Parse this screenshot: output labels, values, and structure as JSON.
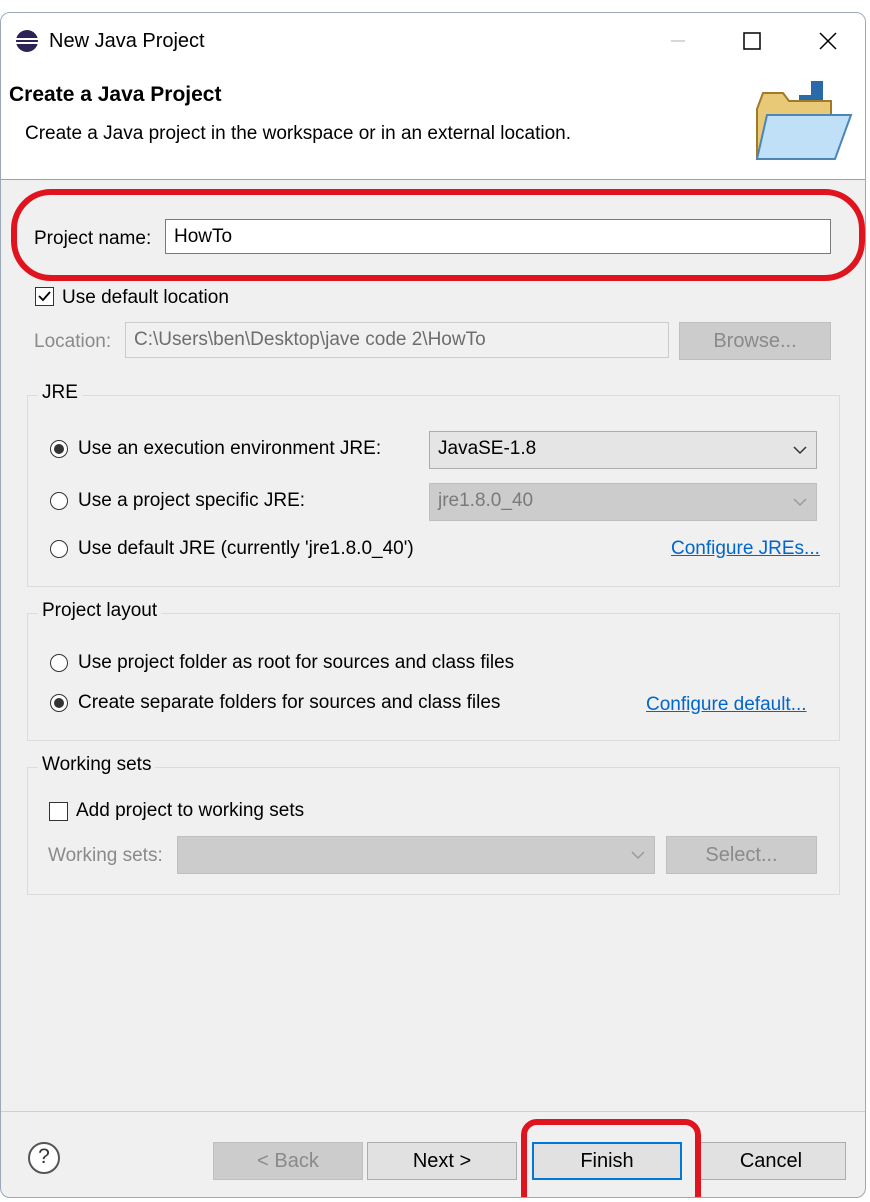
{
  "window": {
    "title": "New Java Project"
  },
  "header": {
    "title": "Create a Java Project",
    "description": "Create a Java project in the workspace or in an external location."
  },
  "project_name": {
    "label": "Project name:",
    "value": "HowTo"
  },
  "location": {
    "use_default_label": "Use default location",
    "use_default_checked": true,
    "label": "Location:",
    "value": "C:\\Users\\ben\\Desktop\\jave code 2\\HowTo",
    "browse_label": "Browse..."
  },
  "jre": {
    "group_title": "JRE",
    "option_exec_env": "Use an execution environment JRE:",
    "exec_env_value": "JavaSE-1.8",
    "option_project_specific": "Use a project specific JRE:",
    "project_specific_value": "jre1.8.0_40",
    "option_default": "Use default JRE (currently 'jre1.8.0_40')",
    "configure_link": "Configure JREs..."
  },
  "layout": {
    "group_title": "Project layout",
    "option_root": "Use project folder as root for sources and class files",
    "option_separate": "Create separate folders for sources and class files",
    "configure_link": "Configure default..."
  },
  "working_sets": {
    "group_title": "Working sets",
    "add_label": "Add project to working sets",
    "add_checked": false,
    "sets_label": "Working sets:",
    "select_label": "Select..."
  },
  "footer": {
    "help_symbol": "?",
    "back_label": "< Back",
    "next_label": "Next >",
    "finish_label": "Finish",
    "cancel_label": "Cancel"
  },
  "colors": {
    "annotation": "#e0141e",
    "link": "#0066cc",
    "focus": "#0078d7"
  }
}
